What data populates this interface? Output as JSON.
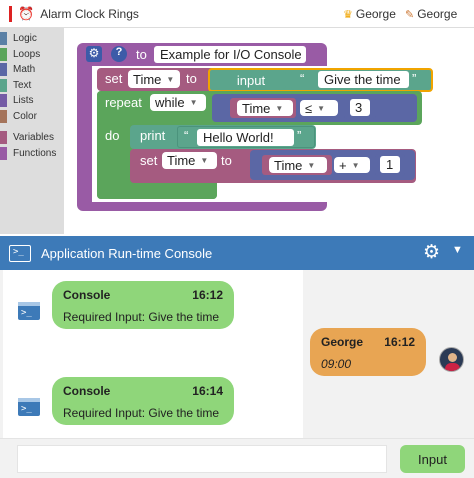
{
  "topbar": {
    "title": "Alarm Clock Rings",
    "users": [
      "George",
      "George"
    ]
  },
  "toolbox": {
    "categories": [
      {
        "label": "Logic",
        "color": "#5b80a5"
      },
      {
        "label": "Loops",
        "color": "#5ba55b"
      },
      {
        "label": "Math",
        "color": "#5b67a5"
      },
      {
        "label": "Text",
        "color": "#5ba58c"
      },
      {
        "label": "Lists",
        "color": "#745ba5"
      },
      {
        "label": "Color",
        "color": "#a5745b"
      },
      {
        "label": "Variables",
        "color": "#a55b80"
      },
      {
        "label": "Functions",
        "color": "#995ba5"
      }
    ]
  },
  "blocks": {
    "procedure": {
      "to": "to",
      "name": "Example for I/O Console"
    },
    "set1": {
      "set": "set",
      "var": "Time",
      "to": "to",
      "input": "input",
      "prompt": "Give the time"
    },
    "repeat": {
      "label": "repeat",
      "mode": "while",
      "var": "Time",
      "op": "≤",
      "value": "3"
    },
    "do": {
      "label": "do"
    },
    "print": {
      "label": "print",
      "text": "Hello World!"
    },
    "set2": {
      "set": "set",
      "var": "Time",
      "to": "to",
      "var2": "Time",
      "op": "+",
      "value": "1"
    }
  },
  "console": {
    "title": "Application Run-time Console",
    "messages": [
      {
        "sender": "Console",
        "time": "16:12",
        "text": "Required Input: Give the time"
      },
      {
        "sender": "George",
        "time": "16:12",
        "text": "09:00"
      },
      {
        "sender": "Console",
        "time": "16:14",
        "text": "Required Input: Give the time"
      }
    ],
    "input_value": "",
    "input_button": "Input"
  }
}
